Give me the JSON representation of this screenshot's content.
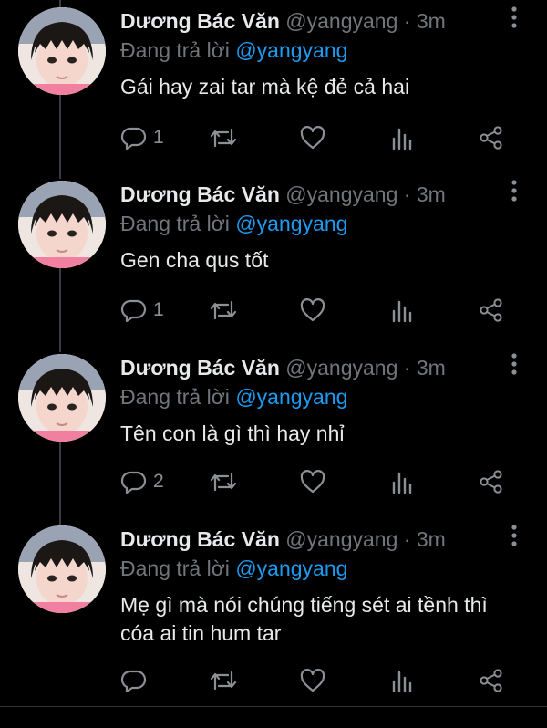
{
  "tweets": [
    {
      "name": "Dương Bác Văn",
      "handle": "@yangyang",
      "dot": "·",
      "time": "3m",
      "reply_prefix": "Đang trả lời",
      "reply_to": "@yangyang",
      "text": "Gái hay zai tar mà kệ đẻ cả hai",
      "reply_count": "1"
    },
    {
      "name": "Dương Bác Văn",
      "handle": "@yangyang",
      "dot": "·",
      "time": "3m",
      "reply_prefix": "Đang trả lời",
      "reply_to": "@yangyang",
      "text": "Gen cha qus tốt",
      "reply_count": "1"
    },
    {
      "name": "Dương Bác Văn",
      "handle": "@yangyang",
      "dot": "·",
      "time": "3m",
      "reply_prefix": "Đang trả lời",
      "reply_to": "@yangyang",
      "text": "Tên con là gì thì hay nhỉ",
      "reply_count": "2"
    },
    {
      "name": "Dương Bác Văn",
      "handle": "@yangyang",
      "dot": "·",
      "time": "3m",
      "reply_prefix": "Đang trả lời",
      "reply_to": "@yangyang",
      "text": "Mẹ gì mà nói chúng tiếng sét ai tềnh thì cóa ai tin hum tar",
      "reply_count": ""
    }
  ],
  "colors": {
    "background": "#000000",
    "text": "#e7e9ea",
    "muted": "#71767b",
    "mention": "#1d9bf0",
    "thread_line": "#3a3d40"
  },
  "icons": [
    "more-vertical-icon",
    "reply-icon",
    "retweet-icon",
    "like-icon",
    "views-icon",
    "share-icon"
  ]
}
